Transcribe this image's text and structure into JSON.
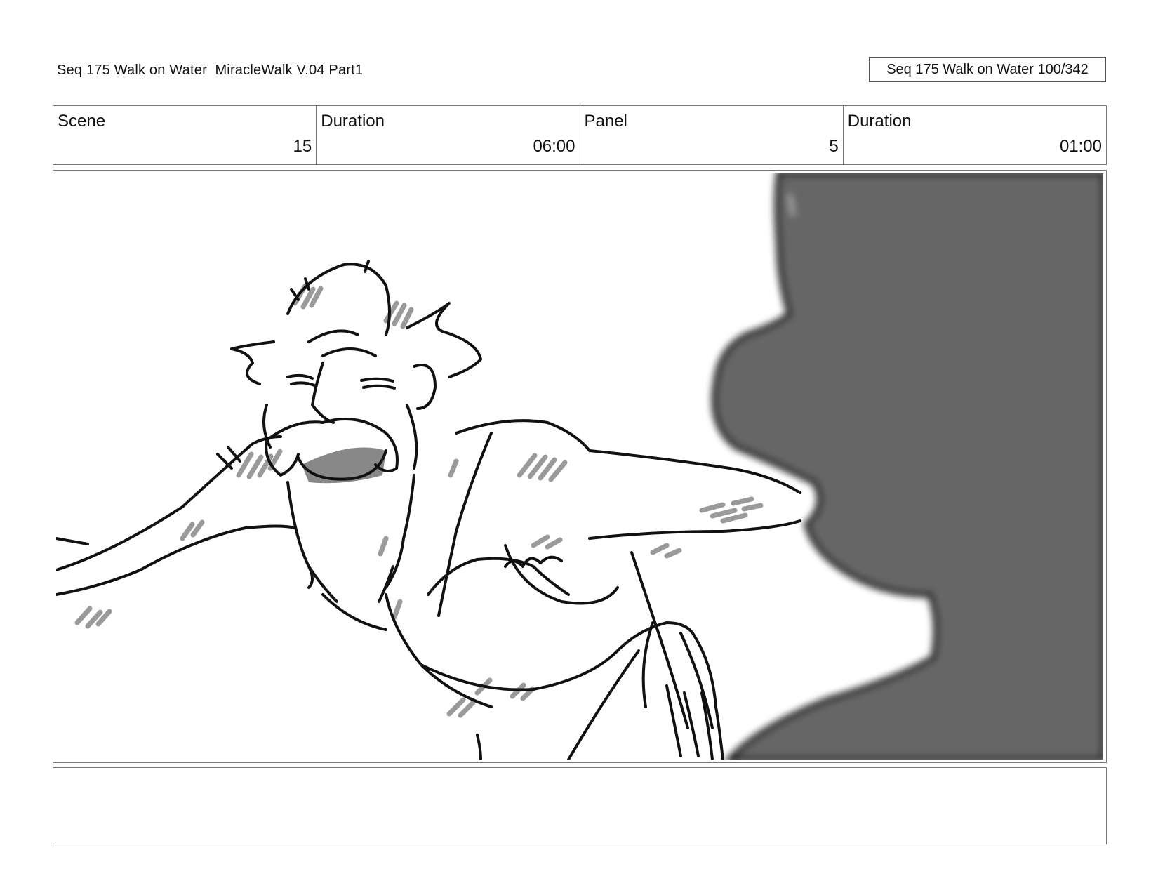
{
  "header": {
    "title": "Seq 175 Walk on Water  MiracleWalk V.04 Part1",
    "page_indicator": "Seq 175 Walk on Water 100/342"
  },
  "info": {
    "scene_label": "Scene",
    "scene_value": "15",
    "scene_duration_label": "Duration",
    "scene_duration_value": "06:00",
    "panel_label": "Panel",
    "panel_value": "5",
    "panel_duration_label": "Duration",
    "panel_duration_value": "01:00"
  },
  "panel": {
    "image": "storyboard-sketch",
    "silhouette_color": "#666666"
  },
  "caption": {
    "text": ""
  }
}
